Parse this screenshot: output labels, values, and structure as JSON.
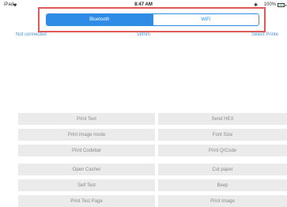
{
  "status": {
    "carrier": "iPad",
    "time": "8:47 AM",
    "bluetooth": "✱",
    "battery": "100%"
  },
  "tabs": [
    {
      "label": "Bluetooth"
    },
    {
      "label": "WiFi"
    }
  ],
  "info": {
    "connection": "Not connected",
    "paper": "58mm",
    "select": "Select Printe"
  },
  "buttons": {
    "print_text": "Print Text",
    "send_hex": "Send HEX",
    "print_image_mode": "Print Image mode",
    "font_size": "Font Size",
    "print_codebar": "Print Codebar",
    "print_qrcode": "Print QrCode",
    "open_casher": "Open Casher",
    "cut_paper": "Cut paper",
    "self_test": "Self Test",
    "beep": "Beep",
    "print_test_page": "Print Test Page",
    "print_image": "Print Image"
  },
  "colors": {
    "accent": "#2f8ce6",
    "highlight": "#e05a5a",
    "button_bg": "#ebebeb"
  }
}
